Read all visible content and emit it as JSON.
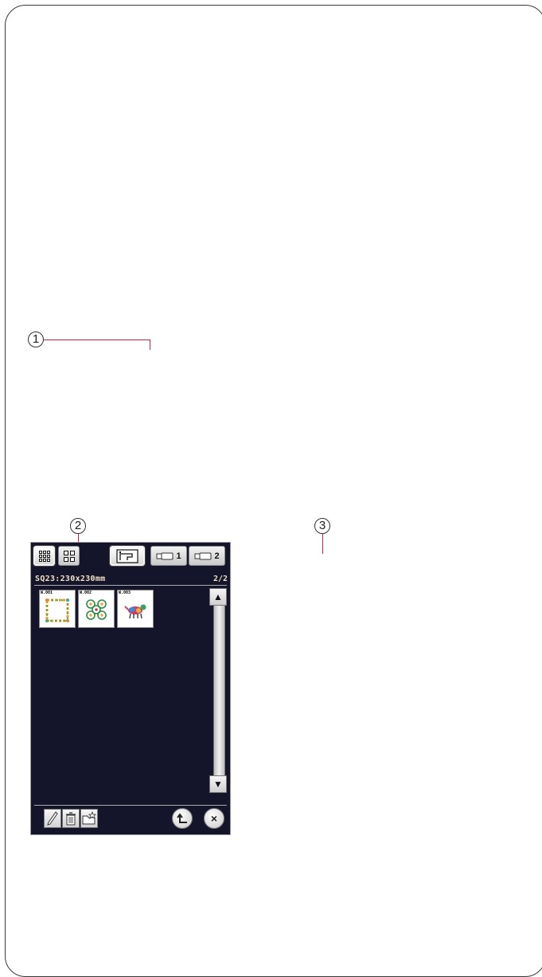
{
  "callouts": {
    "c1": "1",
    "c2": "2",
    "c3": "3"
  },
  "screen": {
    "usb_buttons": [
      {
        "label": "1",
        "icon": "usb-stick-icon"
      },
      {
        "label": "2",
        "icon": "usb-stick-icon"
      }
    ],
    "file_title": "SQ23:230x230mm",
    "page_count": "2/2",
    "thumbnails": [
      {
        "code": "W.001",
        "icon": "frame-design-icon"
      },
      {
        "code": "W.002",
        "icon": "quilt-design-icon"
      },
      {
        "code": "W.003",
        "icon": "animal-design-icon"
      }
    ],
    "scroll_up": "▲",
    "scroll_down": "▼",
    "close_symbol": "×",
    "colors": {
      "background": "#14142a",
      "title_text": "#f1e2c6",
      "leader_line": "#c8283c"
    }
  }
}
